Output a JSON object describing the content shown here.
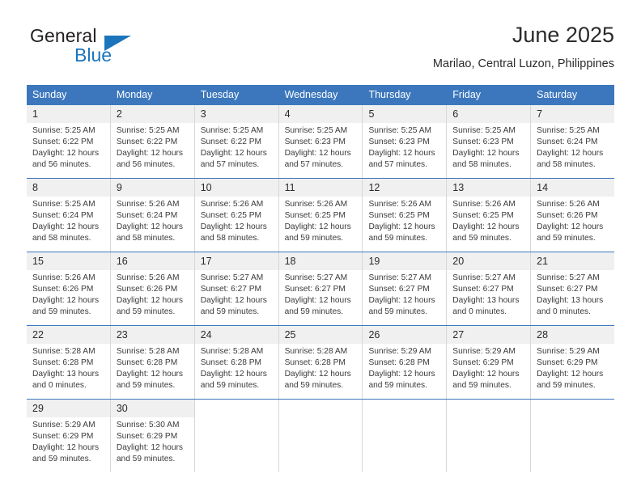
{
  "logo": {
    "word1": "General",
    "word2": "Blue",
    "accent_color": "#1b75bc"
  },
  "header": {
    "month_title": "June 2025",
    "location": "Marilao, Central Luzon, Philippines",
    "header_color": "#3c77bd"
  },
  "calendar": {
    "weekdays": [
      "Sunday",
      "Monday",
      "Tuesday",
      "Wednesday",
      "Thursday",
      "Friday",
      "Saturday"
    ],
    "weeks": [
      [
        {
          "day": "1",
          "sunrise": "Sunrise: 5:25 AM",
          "sunset": "Sunset: 6:22 PM",
          "daylight": "Daylight: 12 hours and 56 minutes."
        },
        {
          "day": "2",
          "sunrise": "Sunrise: 5:25 AM",
          "sunset": "Sunset: 6:22 PM",
          "daylight": "Daylight: 12 hours and 56 minutes."
        },
        {
          "day": "3",
          "sunrise": "Sunrise: 5:25 AM",
          "sunset": "Sunset: 6:22 PM",
          "daylight": "Daylight: 12 hours and 57 minutes."
        },
        {
          "day": "4",
          "sunrise": "Sunrise: 5:25 AM",
          "sunset": "Sunset: 6:23 PM",
          "daylight": "Daylight: 12 hours and 57 minutes."
        },
        {
          "day": "5",
          "sunrise": "Sunrise: 5:25 AM",
          "sunset": "Sunset: 6:23 PM",
          "daylight": "Daylight: 12 hours and 57 minutes."
        },
        {
          "day": "6",
          "sunrise": "Sunrise: 5:25 AM",
          "sunset": "Sunset: 6:23 PM",
          "daylight": "Daylight: 12 hours and 58 minutes."
        },
        {
          "day": "7",
          "sunrise": "Sunrise: 5:25 AM",
          "sunset": "Sunset: 6:24 PM",
          "daylight": "Daylight: 12 hours and 58 minutes."
        }
      ],
      [
        {
          "day": "8",
          "sunrise": "Sunrise: 5:25 AM",
          "sunset": "Sunset: 6:24 PM",
          "daylight": "Daylight: 12 hours and 58 minutes."
        },
        {
          "day": "9",
          "sunrise": "Sunrise: 5:26 AM",
          "sunset": "Sunset: 6:24 PM",
          "daylight": "Daylight: 12 hours and 58 minutes."
        },
        {
          "day": "10",
          "sunrise": "Sunrise: 5:26 AM",
          "sunset": "Sunset: 6:25 PM",
          "daylight": "Daylight: 12 hours and 58 minutes."
        },
        {
          "day": "11",
          "sunrise": "Sunrise: 5:26 AM",
          "sunset": "Sunset: 6:25 PM",
          "daylight": "Daylight: 12 hours and 59 minutes."
        },
        {
          "day": "12",
          "sunrise": "Sunrise: 5:26 AM",
          "sunset": "Sunset: 6:25 PM",
          "daylight": "Daylight: 12 hours and 59 minutes."
        },
        {
          "day": "13",
          "sunrise": "Sunrise: 5:26 AM",
          "sunset": "Sunset: 6:25 PM",
          "daylight": "Daylight: 12 hours and 59 minutes."
        },
        {
          "day": "14",
          "sunrise": "Sunrise: 5:26 AM",
          "sunset": "Sunset: 6:26 PM",
          "daylight": "Daylight: 12 hours and 59 minutes."
        }
      ],
      [
        {
          "day": "15",
          "sunrise": "Sunrise: 5:26 AM",
          "sunset": "Sunset: 6:26 PM",
          "daylight": "Daylight: 12 hours and 59 minutes."
        },
        {
          "day": "16",
          "sunrise": "Sunrise: 5:26 AM",
          "sunset": "Sunset: 6:26 PM",
          "daylight": "Daylight: 12 hours and 59 minutes."
        },
        {
          "day": "17",
          "sunrise": "Sunrise: 5:27 AM",
          "sunset": "Sunset: 6:27 PM",
          "daylight": "Daylight: 12 hours and 59 minutes."
        },
        {
          "day": "18",
          "sunrise": "Sunrise: 5:27 AM",
          "sunset": "Sunset: 6:27 PM",
          "daylight": "Daylight: 12 hours and 59 minutes."
        },
        {
          "day": "19",
          "sunrise": "Sunrise: 5:27 AM",
          "sunset": "Sunset: 6:27 PM",
          "daylight": "Daylight: 12 hours and 59 minutes."
        },
        {
          "day": "20",
          "sunrise": "Sunrise: 5:27 AM",
          "sunset": "Sunset: 6:27 PM",
          "daylight": "Daylight: 13 hours and 0 minutes."
        },
        {
          "day": "21",
          "sunrise": "Sunrise: 5:27 AM",
          "sunset": "Sunset: 6:27 PM",
          "daylight": "Daylight: 13 hours and 0 minutes."
        }
      ],
      [
        {
          "day": "22",
          "sunrise": "Sunrise: 5:28 AM",
          "sunset": "Sunset: 6:28 PM",
          "daylight": "Daylight: 13 hours and 0 minutes."
        },
        {
          "day": "23",
          "sunrise": "Sunrise: 5:28 AM",
          "sunset": "Sunset: 6:28 PM",
          "daylight": "Daylight: 12 hours and 59 minutes."
        },
        {
          "day": "24",
          "sunrise": "Sunrise: 5:28 AM",
          "sunset": "Sunset: 6:28 PM",
          "daylight": "Daylight: 12 hours and 59 minutes."
        },
        {
          "day": "25",
          "sunrise": "Sunrise: 5:28 AM",
          "sunset": "Sunset: 6:28 PM",
          "daylight": "Daylight: 12 hours and 59 minutes."
        },
        {
          "day": "26",
          "sunrise": "Sunrise: 5:29 AM",
          "sunset": "Sunset: 6:28 PM",
          "daylight": "Daylight: 12 hours and 59 minutes."
        },
        {
          "day": "27",
          "sunrise": "Sunrise: 5:29 AM",
          "sunset": "Sunset: 6:29 PM",
          "daylight": "Daylight: 12 hours and 59 minutes."
        },
        {
          "day": "28",
          "sunrise": "Sunrise: 5:29 AM",
          "sunset": "Sunset: 6:29 PM",
          "daylight": "Daylight: 12 hours and 59 minutes."
        }
      ],
      [
        {
          "day": "29",
          "sunrise": "Sunrise: 5:29 AM",
          "sunset": "Sunset: 6:29 PM",
          "daylight": "Daylight: 12 hours and 59 minutes."
        },
        {
          "day": "30",
          "sunrise": "Sunrise: 5:30 AM",
          "sunset": "Sunset: 6:29 PM",
          "daylight": "Daylight: 12 hours and 59 minutes."
        },
        {
          "day": "",
          "sunrise": "",
          "sunset": "",
          "daylight": ""
        },
        {
          "day": "",
          "sunrise": "",
          "sunset": "",
          "daylight": ""
        },
        {
          "day": "",
          "sunrise": "",
          "sunset": "",
          "daylight": ""
        },
        {
          "day": "",
          "sunrise": "",
          "sunset": "",
          "daylight": ""
        },
        {
          "day": "",
          "sunrise": "",
          "sunset": "",
          "daylight": ""
        }
      ]
    ]
  }
}
